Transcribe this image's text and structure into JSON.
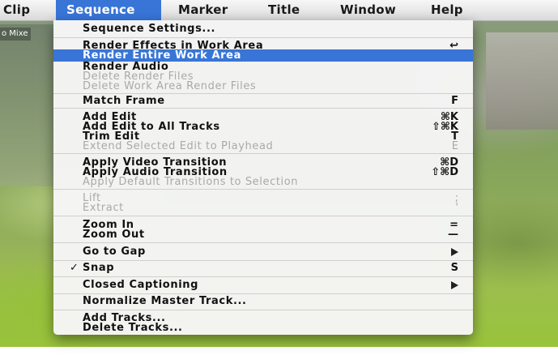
{
  "menubar": {
    "items": [
      {
        "label": "Clip"
      },
      {
        "label": "Sequence"
      },
      {
        "label": "Marker"
      },
      {
        "label": "Title"
      },
      {
        "label": "Window"
      },
      {
        "label": "Help"
      }
    ]
  },
  "panel": {
    "label": "o Mixe"
  },
  "menu": {
    "items": [
      {
        "label": "Sequence Settings...",
        "shortcut": ""
      },
      {
        "label": "Render Effects in Work Area",
        "shortcut": "↩"
      },
      {
        "label": "Render Entire Work Area",
        "shortcut": ""
      },
      {
        "label": "Render Audio",
        "shortcut": ""
      },
      {
        "label": "Delete Render Files",
        "shortcut": ""
      },
      {
        "label": "Delete Work Area Render Files",
        "shortcut": ""
      },
      {
        "label": "Match Frame",
        "shortcut": "F"
      },
      {
        "label": "Add Edit",
        "shortcut": "⌘K"
      },
      {
        "label": "Add Edit to All Tracks",
        "shortcut": "⇧⌘K"
      },
      {
        "label": "Trim Edit",
        "shortcut": "T"
      },
      {
        "label": "Extend Selected Edit to Playhead",
        "shortcut": "E"
      },
      {
        "label": "Apply Video Transition",
        "shortcut": "⌘D"
      },
      {
        "label": "Apply Audio Transition",
        "shortcut": "⇧⌘D"
      },
      {
        "label": "Apply Default Transitions to Selection",
        "shortcut": ""
      },
      {
        "label": "Lift",
        "shortcut": ";"
      },
      {
        "label": "Extract",
        "shortcut": "'"
      },
      {
        "label": "Zoom In",
        "shortcut": "="
      },
      {
        "label": "Zoom Out",
        "shortcut": "—"
      },
      {
        "label": "Go to Gap",
        "shortcut": ""
      },
      {
        "label": "Snap",
        "shortcut": "S",
        "check": "✓"
      },
      {
        "label": "Closed Captioning",
        "shortcut": ""
      },
      {
        "label": "Normalize Master Track...",
        "shortcut": ""
      },
      {
        "label": "Add Tracks...",
        "shortcut": ""
      },
      {
        "label": "Delete Tracks...",
        "shortcut": ""
      }
    ]
  }
}
